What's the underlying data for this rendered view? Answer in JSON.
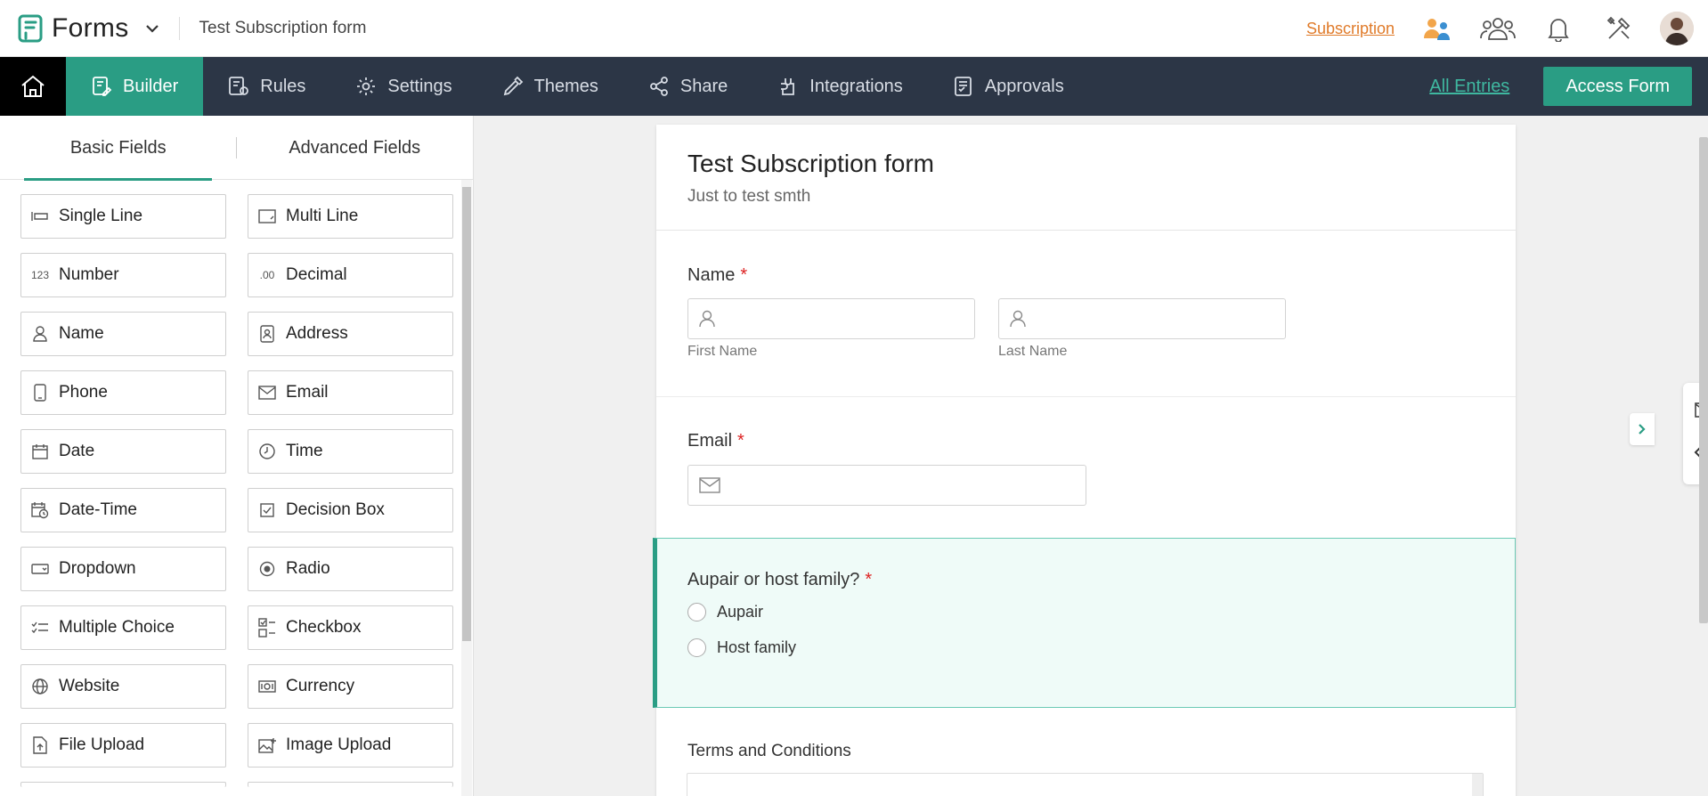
{
  "app": {
    "name": "Forms",
    "form_title": "Test Subscription form"
  },
  "topbar": {
    "subscription_link": "Subscription"
  },
  "nav": {
    "items": [
      {
        "label": "Builder",
        "icon": "builder-icon",
        "active": true
      },
      {
        "label": "Rules",
        "icon": "rules-icon"
      },
      {
        "label": "Settings",
        "icon": "settings-icon"
      },
      {
        "label": "Themes",
        "icon": "themes-icon"
      },
      {
        "label": "Share",
        "icon": "share-icon"
      },
      {
        "label": "Integrations",
        "icon": "integrations-icon"
      },
      {
        "label": "Approvals",
        "icon": "approvals-icon"
      }
    ],
    "all_entries": "All Entries",
    "access_form": "Access Form"
  },
  "left_panel": {
    "tabs": [
      "Basic Fields",
      "Advanced Fields"
    ],
    "fields": [
      {
        "label": "Single Line",
        "icon": "single-line-icon"
      },
      {
        "label": "Multi Line",
        "icon": "multi-line-icon"
      },
      {
        "label": "Number",
        "icon": "number-icon"
      },
      {
        "label": "Decimal",
        "icon": "decimal-icon"
      },
      {
        "label": "Name",
        "icon": "name-icon"
      },
      {
        "label": "Address",
        "icon": "address-icon"
      },
      {
        "label": "Phone",
        "icon": "phone-icon"
      },
      {
        "label": "Email",
        "icon": "email-icon"
      },
      {
        "label": "Date",
        "icon": "date-icon"
      },
      {
        "label": "Time",
        "icon": "time-icon"
      },
      {
        "label": "Date-Time",
        "icon": "date-time-icon"
      },
      {
        "label": "Decision Box",
        "icon": "decision-box-icon"
      },
      {
        "label": "Dropdown",
        "icon": "dropdown-icon"
      },
      {
        "label": "Radio",
        "icon": "radio-icon"
      },
      {
        "label": "Multiple Choice",
        "icon": "multiple-choice-icon"
      },
      {
        "label": "Checkbox",
        "icon": "checkbox-icon"
      },
      {
        "label": "Website",
        "icon": "website-icon"
      },
      {
        "label": "Currency",
        "icon": "currency-icon"
      },
      {
        "label": "File Upload",
        "icon": "file-upload-icon"
      },
      {
        "label": "Image Upload",
        "icon": "image-upload-icon"
      }
    ]
  },
  "form": {
    "title": "Test Subscription form",
    "description": "Just to test smth",
    "name_field": {
      "label": "Name",
      "required_mark": "*",
      "first_sublabel": "First Name",
      "last_sublabel": "Last Name"
    },
    "email_field": {
      "label": "Email",
      "required_mark": "*"
    },
    "radio_field": {
      "label": "Aupair or host family?",
      "required_mark": "*",
      "options": [
        "Aupair",
        "Host family"
      ]
    },
    "terms_field": {
      "label": "Terms and Conditions"
    }
  },
  "colors": {
    "accent": "#2a9d84",
    "nav_bg": "#2c3646",
    "subscription": "#e07b2a"
  }
}
